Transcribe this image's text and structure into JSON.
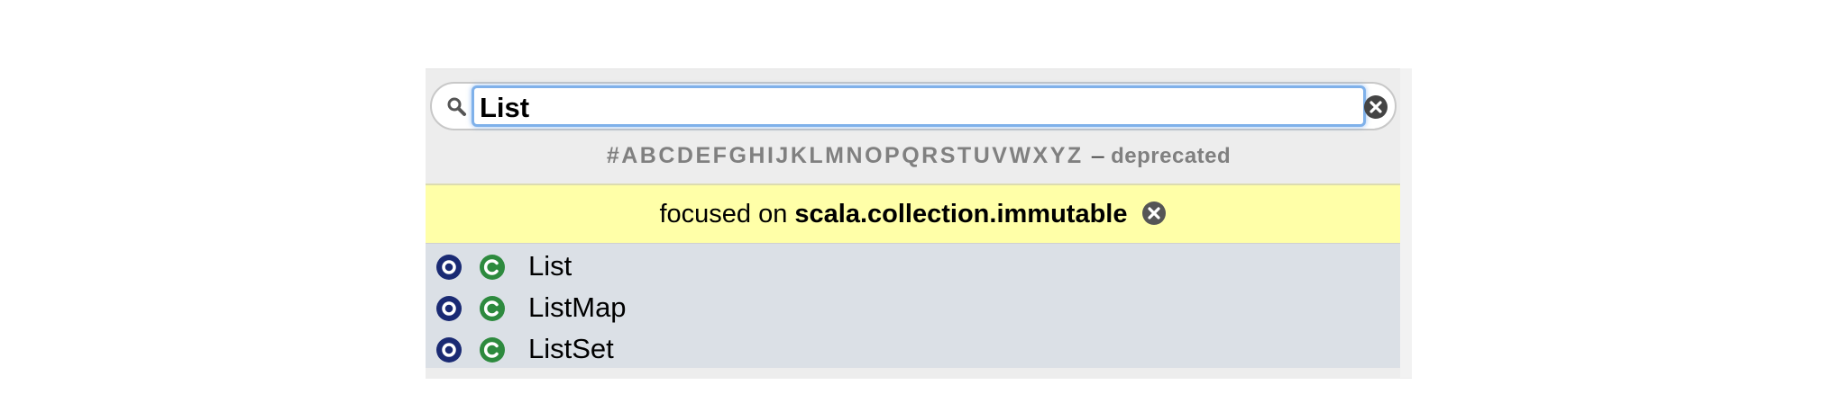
{
  "search": {
    "value": "List",
    "icon": "search-icon",
    "clear_icon": "clear-icon"
  },
  "letter_nav": {
    "letters": [
      "#",
      "A",
      "B",
      "C",
      "D",
      "E",
      "F",
      "G",
      "H",
      "I",
      "J",
      "K",
      "L",
      "M",
      "N",
      "O",
      "P",
      "Q",
      "R",
      "S",
      "T",
      "U",
      "V",
      "W",
      "X",
      "Y",
      "Z"
    ],
    "separator": "–",
    "deprecated_label": "deprecated"
  },
  "focus": {
    "prefix": "focused on",
    "package": "scala.collection.immutable",
    "unfocus_icon": "unfocus-icon"
  },
  "results": [
    {
      "name": "List",
      "kinds": [
        "object",
        "class"
      ]
    },
    {
      "name": "ListMap",
      "kinds": [
        "object",
        "class"
      ]
    },
    {
      "name": "ListSet",
      "kinds": [
        "object",
        "class"
      ]
    }
  ],
  "colors": {
    "object_badge": "#1a2a73",
    "class_badge": "#2d8a3e",
    "focus_bg": "#ffffa8",
    "results_bg": "#dbe0e6",
    "input_glow": "#7fb1ea"
  }
}
